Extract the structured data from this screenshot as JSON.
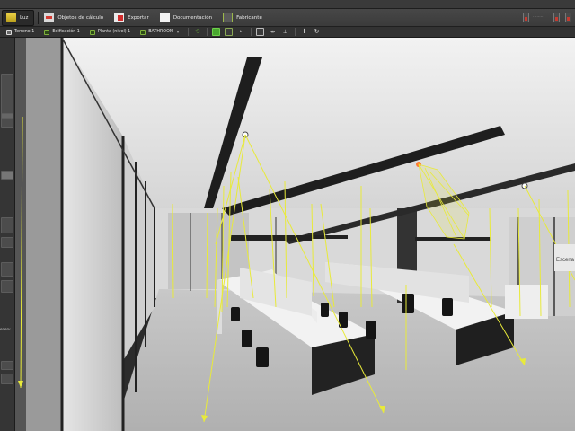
{
  "ribbon": {
    "tabs": [
      {
        "label": "Luz",
        "icon": "light-icon",
        "active": true
      },
      {
        "label": "Objetos de cálculo",
        "icon": "calc-objects-icon",
        "active": false
      },
      {
        "label": "Exportar",
        "icon": "export-icon",
        "active": false
      },
      {
        "label": "Documentación",
        "icon": "documentation-icon",
        "active": false
      },
      {
        "label": "Fabricante",
        "icon": "manufacturer-icon",
        "active": false
      }
    ]
  },
  "subbar": {
    "breadcrumbs": [
      {
        "label": "Terreno 1"
      },
      {
        "label": "Edificación 1"
      },
      {
        "label": "Planta (nivel) 1"
      },
      {
        "label": "BATHROOM"
      }
    ]
  },
  "left_panel": {
    "label_bottom": "enerv"
  },
  "viewport": {
    "label_right": "Escena"
  },
  "colors": {
    "accent_green": "#49a830",
    "light_ray": "#e8ea3a",
    "toolbar_bg": "#3b3b3b"
  }
}
